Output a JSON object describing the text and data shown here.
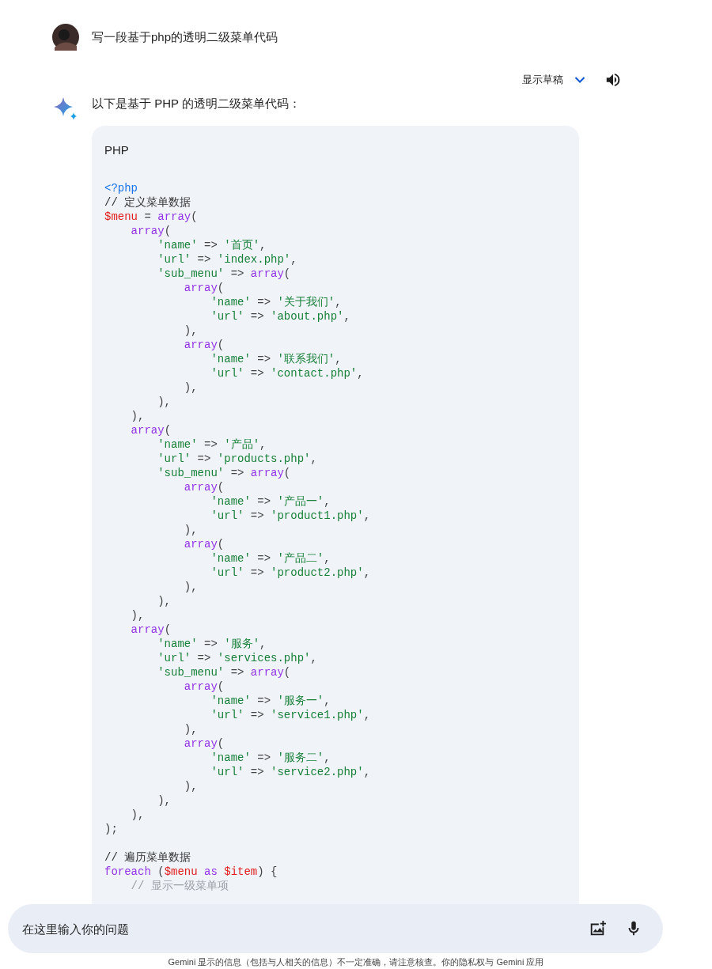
{
  "prompt": {
    "text": "写一段基于php的透明二级菜单代码"
  },
  "toolbar": {
    "drafts_label": "显示草稿"
  },
  "response": {
    "intro": "以下是基于 PHP 的透明二级菜单代码：",
    "code": {
      "language": "PHP",
      "sections": [
        {
          "lines": [
            [
              {
                "kind": "tag",
                "text": "<?php"
              }
            ],
            [
              {
                "kind": "comment",
                "text": "// 定义菜单数据"
              }
            ],
            [
              {
                "kind": "variable",
                "text": "$menu"
              },
              {
                "kind": "plain",
                "text": " = "
              },
              {
                "kind": "keyword",
                "text": "array"
              },
              {
                "kind": "plain",
                "text": "("
              }
            ],
            [
              {
                "kind": "keyword",
                "text": "    array"
              },
              {
                "kind": "plain",
                "text": "("
              }
            ],
            [
              {
                "kind": "string",
                "text": "        'name'"
              },
              {
                "kind": "plain",
                "text": " => "
              },
              {
                "kind": "string",
                "text": "'首页'"
              },
              {
                "kind": "plain",
                "text": ","
              }
            ],
            [
              {
                "kind": "string",
                "text": "        'url'"
              },
              {
                "kind": "plain",
                "text": " => "
              },
              {
                "kind": "string",
                "text": "'index.php'"
              },
              {
                "kind": "plain",
                "text": ","
              }
            ],
            [
              {
                "kind": "string",
                "text": "        'sub_menu'"
              },
              {
                "kind": "plain",
                "text": " => "
              },
              {
                "kind": "keyword",
                "text": "array"
              },
              {
                "kind": "plain",
                "text": "("
              }
            ],
            [
              {
                "kind": "keyword",
                "text": "            array"
              },
              {
                "kind": "plain",
                "text": "("
              }
            ],
            [
              {
                "kind": "string",
                "text": "                'name'"
              },
              {
                "kind": "plain",
                "text": " => "
              },
              {
                "kind": "string",
                "text": "'关于我们'"
              },
              {
                "kind": "plain",
                "text": ","
              }
            ],
            [
              {
                "kind": "string",
                "text": "                'url'"
              },
              {
                "kind": "plain",
                "text": " => "
              },
              {
                "kind": "string",
                "text": "'about.php'"
              },
              {
                "kind": "plain",
                "text": ","
              }
            ],
            [
              {
                "kind": "plain",
                "text": "            ),"
              }
            ],
            [
              {
                "kind": "keyword",
                "text": "            array"
              },
              {
                "kind": "plain",
                "text": "("
              }
            ],
            [
              {
                "kind": "string",
                "text": "                'name'"
              },
              {
                "kind": "plain",
                "text": " => "
              },
              {
                "kind": "string",
                "text": "'联系我们'"
              },
              {
                "kind": "plain",
                "text": ","
              }
            ],
            [
              {
                "kind": "string",
                "text": "                'url'"
              },
              {
                "kind": "plain",
                "text": " => "
              },
              {
                "kind": "string",
                "text": "'contact.php'"
              },
              {
                "kind": "plain",
                "text": ","
              }
            ],
            [
              {
                "kind": "plain",
                "text": "            ),"
              }
            ],
            [
              {
                "kind": "plain",
                "text": "        ),"
              }
            ],
            [
              {
                "kind": "plain",
                "text": "    ),"
              }
            ],
            [
              {
                "kind": "keyword",
                "text": "    array"
              },
              {
                "kind": "plain",
                "text": "("
              }
            ],
            [
              {
                "kind": "string",
                "text": "        'name'"
              },
              {
                "kind": "plain",
                "text": " => "
              },
              {
                "kind": "string",
                "text": "'产品'"
              },
              {
                "kind": "plain",
                "text": ","
              }
            ],
            [
              {
                "kind": "string",
                "text": "        'url'"
              },
              {
                "kind": "plain",
                "text": " => "
              },
              {
                "kind": "string",
                "text": "'products.php'"
              },
              {
                "kind": "plain",
                "text": ","
              }
            ],
            [
              {
                "kind": "string",
                "text": "        'sub_menu'"
              },
              {
                "kind": "plain",
                "text": " => "
              },
              {
                "kind": "keyword",
                "text": "array"
              },
              {
                "kind": "plain",
                "text": "("
              }
            ],
            [
              {
                "kind": "keyword",
                "text": "            array"
              },
              {
                "kind": "plain",
                "text": "("
              }
            ],
            [
              {
                "kind": "string",
                "text": "                'name'"
              },
              {
                "kind": "plain",
                "text": " => "
              },
              {
                "kind": "string",
                "text": "'产品一'"
              },
              {
                "kind": "plain",
                "text": ","
              }
            ],
            [
              {
                "kind": "string",
                "text": "                'url'"
              },
              {
                "kind": "plain",
                "text": " => "
              },
              {
                "kind": "string",
                "text": "'product1.php'"
              },
              {
                "kind": "plain",
                "text": ","
              }
            ],
            [
              {
                "kind": "plain",
                "text": "            ),"
              }
            ],
            [
              {
                "kind": "keyword",
                "text": "            array"
              },
              {
                "kind": "plain",
                "text": "("
              }
            ],
            [
              {
                "kind": "string",
                "text": "                'name'"
              },
              {
                "kind": "plain",
                "text": " => "
              },
              {
                "kind": "string",
                "text": "'产品二'"
              },
              {
                "kind": "plain",
                "text": ","
              }
            ],
            [
              {
                "kind": "string",
                "text": "                'url'"
              },
              {
                "kind": "plain",
                "text": " => "
              },
              {
                "kind": "string",
                "text": "'product2.php'"
              },
              {
                "kind": "plain",
                "text": ","
              }
            ],
            [
              {
                "kind": "plain",
                "text": "            ),"
              }
            ],
            [
              {
                "kind": "plain",
                "text": "        ),"
              }
            ],
            [
              {
                "kind": "plain",
                "text": "    ),"
              }
            ],
            [
              {
                "kind": "keyword",
                "text": "    array"
              },
              {
                "kind": "plain",
                "text": "("
              }
            ],
            [
              {
                "kind": "string",
                "text": "        'name'"
              },
              {
                "kind": "plain",
                "text": " => "
              },
              {
                "kind": "string",
                "text": "'服务'"
              },
              {
                "kind": "plain",
                "text": ","
              }
            ],
            [
              {
                "kind": "string",
                "text": "        'url'"
              },
              {
                "kind": "plain",
                "text": " => "
              },
              {
                "kind": "string",
                "text": "'services.php'"
              },
              {
                "kind": "plain",
                "text": ","
              }
            ],
            [
              {
                "kind": "string",
                "text": "        'sub_menu'"
              },
              {
                "kind": "plain",
                "text": " => "
              },
              {
                "kind": "keyword",
                "text": "array"
              },
              {
                "kind": "plain",
                "text": "("
              }
            ],
            [
              {
                "kind": "keyword",
                "text": "            array"
              },
              {
                "kind": "plain",
                "text": "("
              }
            ],
            [
              {
                "kind": "string",
                "text": "                'name'"
              },
              {
                "kind": "plain",
                "text": " => "
              },
              {
                "kind": "string",
                "text": "'服务一'"
              },
              {
                "kind": "plain",
                "text": ","
              }
            ],
            [
              {
                "kind": "string",
                "text": "                'url'"
              },
              {
                "kind": "plain",
                "text": " => "
              },
              {
                "kind": "string",
                "text": "'service1.php'"
              },
              {
                "kind": "plain",
                "text": ","
              }
            ],
            [
              {
                "kind": "plain",
                "text": "            ),"
              }
            ],
            [
              {
                "kind": "keyword",
                "text": "            array"
              },
              {
                "kind": "plain",
                "text": "("
              }
            ],
            [
              {
                "kind": "string",
                "text": "                'name'"
              },
              {
                "kind": "plain",
                "text": " => "
              },
              {
                "kind": "string",
                "text": "'服务二'"
              },
              {
                "kind": "plain",
                "text": ","
              }
            ],
            [
              {
                "kind": "string",
                "text": "                'url'"
              },
              {
                "kind": "plain",
                "text": " => "
              },
              {
                "kind": "string",
                "text": "'service2.php'"
              },
              {
                "kind": "plain",
                "text": ","
              }
            ],
            [
              {
                "kind": "plain",
                "text": "            ),"
              }
            ],
            [
              {
                "kind": "plain",
                "text": "        ),"
              }
            ],
            [
              {
                "kind": "plain",
                "text": "    ),"
              }
            ],
            [
              {
                "kind": "plain",
                "text": ");"
              }
            ]
          ]
        },
        {
          "lines": [
            [
              {
                "kind": "comment",
                "text": "// 遍历菜单数据"
              }
            ],
            [
              {
                "kind": "keyword",
                "text": "foreach"
              },
              {
                "kind": "plain",
                "text": " ("
              },
              {
                "kind": "variable",
                "text": "$menu"
              },
              {
                "kind": "keyword",
                "text": " as"
              },
              {
                "kind": "variable",
                "text": " $item"
              },
              {
                "kind": "plain",
                "text": ") {"
              }
            ],
            [
              {
                "kind": "faded",
                "text": "    // 显示一级菜单项"
              }
            ]
          ]
        }
      ]
    }
  },
  "input": {
    "placeholder": "在这里输入你的问题"
  },
  "footer": {
    "text": "Gemini 显示的信息（包括与人相关的信息）不一定准确，请注意核查。你的隐私权与 Gemini 应用"
  }
}
